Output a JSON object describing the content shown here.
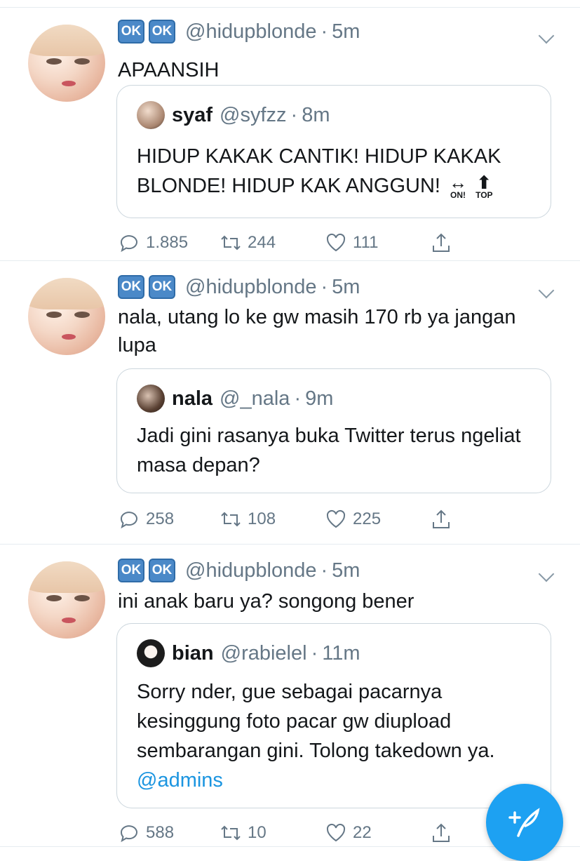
{
  "tweets": [
    {
      "badges": [
        "OK",
        "OK"
      ],
      "handle": "@hidupblonde",
      "time": "5m",
      "text": "APAANSIH",
      "quote": {
        "name": "syaf",
        "handle": "@syfzz",
        "time": "8m",
        "text": "HIDUP KAKAK CANTIK! HIDUP KAKAK BLONDE! HIDUP KAK ANGGUN!",
        "emojis": [
          {
            "glyph": "↔",
            "label": "ON!",
            "icon": "on-arrow-icon"
          },
          {
            "glyph": "⬆",
            "label": "TOP",
            "icon": "top-arrow-icon"
          }
        ]
      },
      "replies": "1.885",
      "retweets": "244",
      "likes": "111"
    },
    {
      "badges": [
        "OK",
        "OK"
      ],
      "handle": "@hidupblonde",
      "time": "5m",
      "text": "nala, utang lo ke gw masih 170 rb ya jangan lupa",
      "quote": {
        "name": "nala",
        "handle": "@_nala",
        "time": "9m",
        "text": "Jadi gini rasanya buka Twitter terus ngeliat masa depan?"
      },
      "replies": "258",
      "retweets": "108",
      "likes": "225"
    },
    {
      "badges": [
        "OK",
        "OK"
      ],
      "handle": "@hidupblonde",
      "time": "5m",
      "text": "ini anak baru ya? songong bener",
      "quote": {
        "name": "bian",
        "handle": "@rabielel",
        "time": "11m",
        "text": "Sorry nder, gue sebagai pacarnya kesinggung foto pacar gw diupload sembarangan gini. Tolong takedown ya.",
        "mention": "@admins"
      },
      "replies": "588",
      "retweets": "10",
      "likes": "22"
    }
  ],
  "separator": "·",
  "colors": {
    "accent": "#1da1f2",
    "secondary_text": "#657786",
    "badge": "#4b89c8"
  }
}
